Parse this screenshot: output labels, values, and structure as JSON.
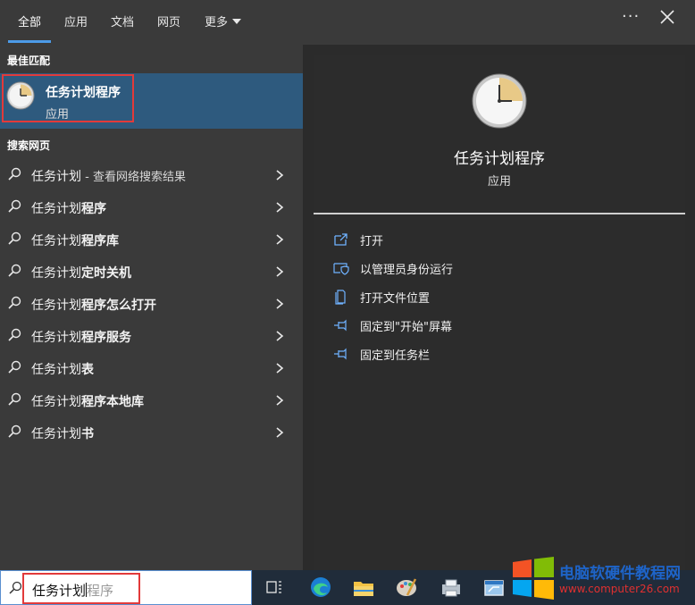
{
  "tabs": [
    {
      "label": "全部",
      "active": true
    },
    {
      "label": "应用"
    },
    {
      "label": "文档"
    },
    {
      "label": "网页"
    },
    {
      "label": "更多"
    }
  ],
  "best_match": {
    "section_label": "最佳匹配",
    "title": "任务计划程序",
    "subtitle": "应用"
  },
  "web": {
    "section_label": "搜索网页",
    "items": [
      {
        "query": "任务计划",
        "suffix": " - 查看网络搜索结果"
      },
      {
        "query": "任务计划",
        "suffix_bold": "程序"
      },
      {
        "query": "任务计划",
        "suffix_bold": "程序库"
      },
      {
        "query": "任务计划",
        "suffix_bold": "定时关机"
      },
      {
        "query": "任务计划",
        "suffix_bold": "程序怎么打开"
      },
      {
        "query": "任务计划",
        "suffix_bold": "程序服务"
      },
      {
        "query": "任务计划",
        "suffix_bold": "表"
      },
      {
        "query": "任务计划",
        "suffix_bold": "程序本地库"
      },
      {
        "query": "任务计划",
        "suffix_bold": "书"
      }
    ]
  },
  "detail": {
    "app_name": "任务计划程序",
    "app_type": "应用",
    "icon": "clock-icon",
    "actions": [
      {
        "label": "打开",
        "icon": "open-icon"
      },
      {
        "label": "以管理员身份运行",
        "icon": "shield-icon"
      },
      {
        "label": "打开文件位置",
        "icon": "file-location-icon"
      },
      {
        "label": "固定到\"开始\"屏幕",
        "icon": "pin-icon"
      },
      {
        "label": "固定到任务栏",
        "icon": "pin-icon"
      }
    ]
  },
  "search": {
    "typed": "任务计划",
    "suggestion": "程序"
  },
  "taskbar": {
    "icons": [
      "task-view-icon",
      "edge-icon",
      "file-explorer-icon",
      "paint-icon",
      "printer-app-icon",
      "window-app-icon"
    ]
  },
  "watermark": {
    "title": "电脑软硬件教程网",
    "url": "www.computer26.com"
  },
  "colors": {
    "accent": "#4c9be8",
    "selected_bg": "#2e5a7e",
    "highlight_border": "#e23a3a"
  }
}
